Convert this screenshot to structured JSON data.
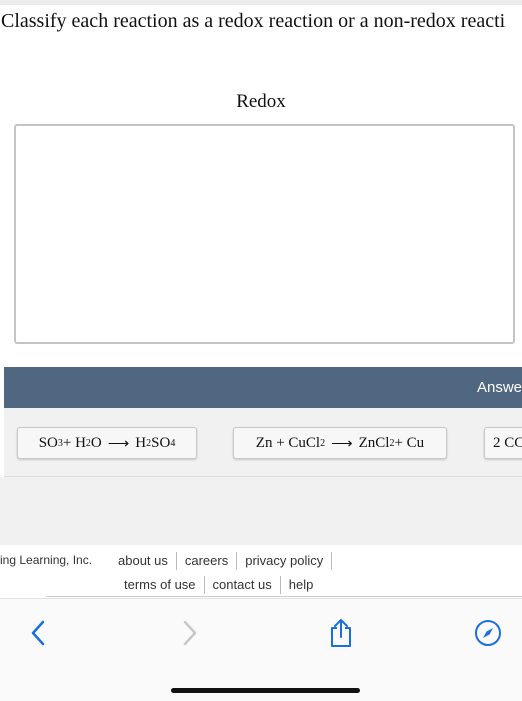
{
  "question": {
    "text": "Classify each reaction as a redox reaction or a non-redox reacti"
  },
  "bins": [
    {
      "title": "Redox"
    }
  ],
  "answer_bank": {
    "label": "Answe",
    "items": [
      {
        "parts": [
          "SO",
          "3",
          " + H",
          "2",
          "O",
          "⟶",
          "H",
          "2",
          "SO",
          "4"
        ]
      },
      {
        "parts": [
          "Zn + CuCl",
          "2",
          "⟶",
          "ZnCl",
          "2",
          " + Cu"
        ]
      },
      {
        "parts": [
          "2 CC"
        ]
      }
    ]
  },
  "footer": {
    "copyright": "ing Learning, Inc.",
    "links_row1": [
      "about us",
      "careers",
      "privacy policy"
    ],
    "links_row2": [
      "terms of use",
      "contact us",
      "help"
    ]
  },
  "browser_toolbar": {
    "icons": [
      "back-icon",
      "forward-icon",
      "share-icon",
      "compass-icon"
    ],
    "accent_color": "#1a6fe0",
    "disabled_color": "#c8c8c8"
  }
}
